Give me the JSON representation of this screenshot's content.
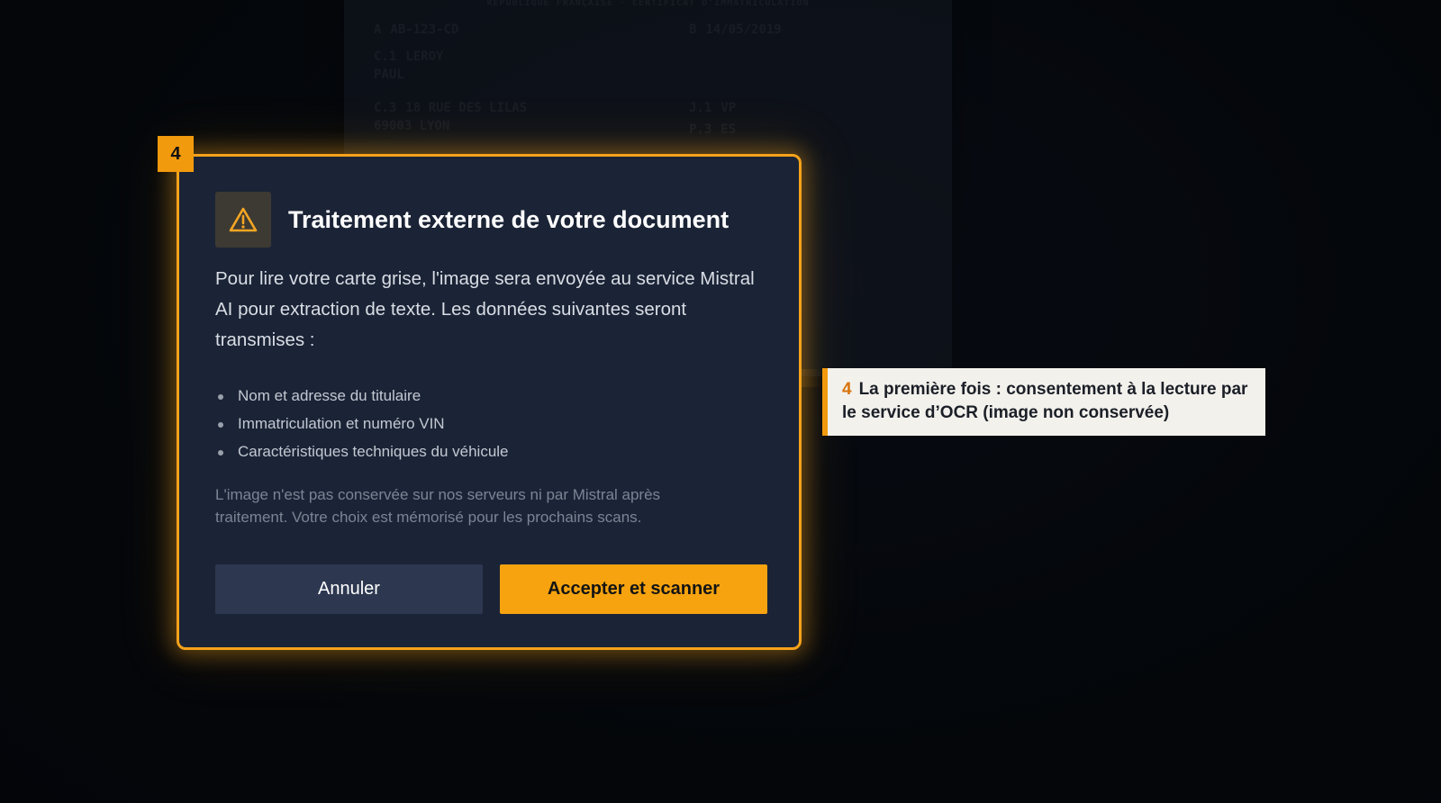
{
  "background_document": {
    "header": "RÉPUBLIQUE FRANÇAISE · CERTIFICAT D'IMMATRICULATION",
    "fields": [
      {
        "code": "A",
        "value": "AB-123-CD"
      },
      {
        "code": "B",
        "value": "14/05/2019"
      },
      {
        "code": "C.1",
        "value": "LEROY"
      },
      {
        "code": "",
        "value": "PAUL"
      },
      {
        "code": "C.3",
        "value": "18 RUE DES LILAS"
      },
      {
        "code": "",
        "value": "69003 LYON"
      },
      {
        "code": "J.1",
        "value": "VP"
      },
      {
        "code": "P.3",
        "value": "ES"
      }
    ]
  },
  "step_badge": "4",
  "modal": {
    "icon": "warning-triangle-icon",
    "title": "Traitement externe de votre document",
    "intro": "Pour lire votre carte grise, l'image sera envoyée au service Mistral AI pour extraction de texte. Les données suivantes seront transmises :",
    "items": [
      "Nom et adresse du titulaire",
      "Immatriculation et numéro VIN",
      "Caractéristiques techniques du véhicule"
    ],
    "note": "L'image n'est pas conservée sur nos serveurs ni par Mistral après traitement. Votre choix est mémorisé pour les prochains scans.",
    "cancel_label": "Annuler",
    "accept_label": "Accepter et scanner"
  },
  "callout": {
    "number": "4",
    "text": "La première fois : consentement à la lecture par le service d’OCR (image non conservée)"
  },
  "colors": {
    "accent": "#f6a21a",
    "modal_bg": "#1b2436",
    "cancel_bg": "#2d3850",
    "callout_bg": "#f3f1ec"
  }
}
